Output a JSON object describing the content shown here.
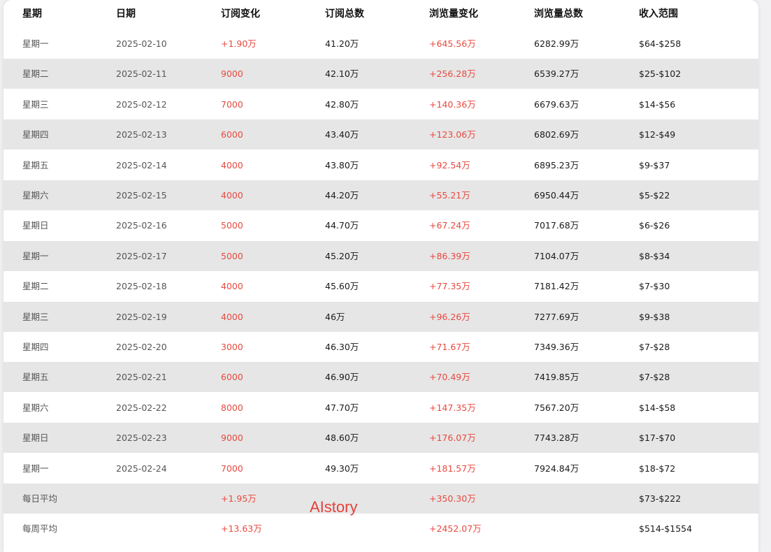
{
  "headers": [
    "星期",
    "日期",
    "订阅变化",
    "订阅总数",
    "浏览量变化",
    "浏览量总数",
    "收入范围"
  ],
  "rows": [
    {
      "weekday": "星期一",
      "date": "2025-02-10",
      "sub_change": "+1.90万",
      "sub_total": "41.20万",
      "view_change": "+645.56万",
      "view_total": "6282.99万",
      "income": "$64-$258"
    },
    {
      "weekday": "星期二",
      "date": "2025-02-11",
      "sub_change": "9000",
      "sub_total": "42.10万",
      "view_change": "+256.28万",
      "view_total": "6539.27万",
      "income": "$25-$102"
    },
    {
      "weekday": "星期三",
      "date": "2025-02-12",
      "sub_change": "7000",
      "sub_total": "42.80万",
      "view_change": "+140.36万",
      "view_total": "6679.63万",
      "income": "$14-$56"
    },
    {
      "weekday": "星期四",
      "date": "2025-02-13",
      "sub_change": "6000",
      "sub_total": "43.40万",
      "view_change": "+123.06万",
      "view_total": "6802.69万",
      "income": "$12-$49"
    },
    {
      "weekday": "星期五",
      "date": "2025-02-14",
      "sub_change": "4000",
      "sub_total": "43.80万",
      "view_change": "+92.54万",
      "view_total": "6895.23万",
      "income": "$9-$37"
    },
    {
      "weekday": "星期六",
      "date": "2025-02-15",
      "sub_change": "4000",
      "sub_total": "44.20万",
      "view_change": "+55.21万",
      "view_total": "6950.44万",
      "income": "$5-$22"
    },
    {
      "weekday": "星期日",
      "date": "2025-02-16",
      "sub_change": "5000",
      "sub_total": "44.70万",
      "view_change": "+67.24万",
      "view_total": "7017.68万",
      "income": "$6-$26"
    },
    {
      "weekday": "星期一",
      "date": "2025-02-17",
      "sub_change": "5000",
      "sub_total": "45.20万",
      "view_change": "+86.39万",
      "view_total": "7104.07万",
      "income": "$8-$34"
    },
    {
      "weekday": "星期二",
      "date": "2025-02-18",
      "sub_change": "4000",
      "sub_total": "45.60万",
      "view_change": "+77.35万",
      "view_total": "7181.42万",
      "income": "$7-$30"
    },
    {
      "weekday": "星期三",
      "date": "2025-02-19",
      "sub_change": "4000",
      "sub_total": "46万",
      "view_change": "+96.26万",
      "view_total": "7277.69万",
      "income": "$9-$38"
    },
    {
      "weekday": "星期四",
      "date": "2025-02-20",
      "sub_change": "3000",
      "sub_total": "46.30万",
      "view_change": "+71.67万",
      "view_total": "7349.36万",
      "income": "$7-$28"
    },
    {
      "weekday": "星期五",
      "date": "2025-02-21",
      "sub_change": "6000",
      "sub_total": "46.90万",
      "view_change": "+70.49万",
      "view_total": "7419.85万",
      "income": "$7-$28"
    },
    {
      "weekday": "星期六",
      "date": "2025-02-22",
      "sub_change": "8000",
      "sub_total": "47.70万",
      "view_change": "+147.35万",
      "view_total": "7567.20万",
      "income": "$14-$58"
    },
    {
      "weekday": "星期日",
      "date": "2025-02-23",
      "sub_change": "9000",
      "sub_total": "48.60万",
      "view_change": "+176.07万",
      "view_total": "7743.28万",
      "income": "$17-$70"
    },
    {
      "weekday": "星期一",
      "date": "2025-02-24",
      "sub_change": "7000",
      "sub_total": "49.30万",
      "view_change": "+181.57万",
      "view_total": "7924.84万",
      "income": "$18-$72"
    }
  ],
  "summary": [
    {
      "label": "每日平均",
      "sub_change": "+1.95万",
      "view_change": "+350.30万",
      "income": "$73-$222"
    },
    {
      "label": "每周平均",
      "sub_change": "+13.63万",
      "view_change": "+2452.07万",
      "income": "$514-$1554"
    }
  ],
  "watermark": "AIstory",
  "colors": {
    "accent_red": "#e8493f",
    "stripe": "#e6e6e6"
  }
}
